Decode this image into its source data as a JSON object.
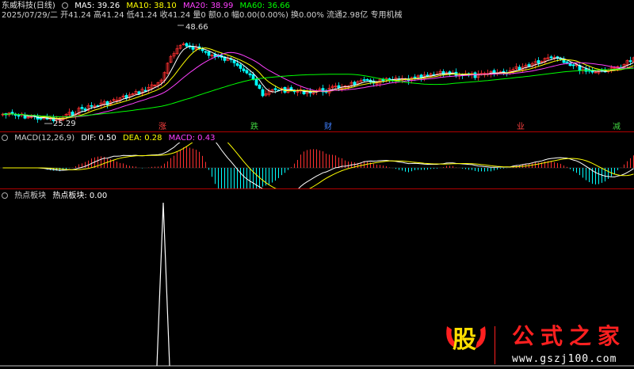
{
  "header": {
    "stock": "东威科技(日线)",
    "ma5": "MA5: 39.26",
    "ma10": "MA10: 38.10",
    "ma20": "MA20: 38.99",
    "ma60": "MA60: 36.66",
    "info": "2025/07/29/二 开41.24 高41.24 低41.24 收41.24 量0 额0.0 幅0.00(0.00%) 换0.00% 流通2.98亿 专用机械"
  },
  "price_panel": {
    "high_label": "48.66",
    "low_label": "25.29",
    "markers": [
      {
        "text": "涨",
        "color": "#ff4040"
      },
      {
        "text": "跌",
        "color": "#40d040"
      },
      {
        "text": "财",
        "color": "#4080ff"
      },
      {
        "text": "业",
        "color": "#ff4040"
      },
      {
        "text": "减",
        "color": "#40d040"
      }
    ]
  },
  "macd_panel": {
    "title": "MACD(12,26,9)",
    "dif": "DIF: 0.50",
    "dea": "DEA: 0.28",
    "macd": "MACD: 0.43"
  },
  "hot_panel": {
    "title": "热点板块",
    "value": "热点板块: 0.00"
  },
  "watermark": {
    "logo_char": "股",
    "title": "公式之家",
    "url": "www.gszj100.com"
  },
  "colors": {
    "ma5": "#ffffff",
    "ma10": "#ffff00",
    "ma20": "#ff40ff",
    "ma60": "#00ff00",
    "up": "#ff3030",
    "down": "#00ffff",
    "divider": "#b00000"
  }
}
